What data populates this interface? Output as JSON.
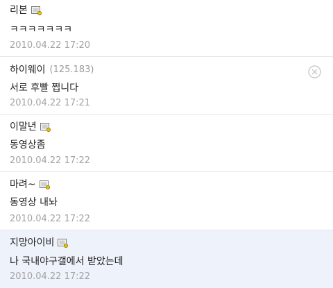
{
  "comments": [
    {
      "author": "리본",
      "ip": "",
      "member_icon": "member-badge-icon",
      "text": "ㅋㅋㅋㅋㅋㅋㅋ",
      "time": "2010.04.22 17:20"
    },
    {
      "author": "하이웨이",
      "ip": "(125.183)",
      "member_icon": "",
      "text": "서로 후빨 쩝니다",
      "time": "2010.04.22 17:21",
      "action_icon": "close-circle-icon"
    },
    {
      "author": "이말년",
      "ip": "",
      "member_icon": "member-badge-icon",
      "text": "동영상좀",
      "time": "2010.04.22 17:22"
    },
    {
      "author": "마려~",
      "ip": "",
      "member_icon": "member-badge-icon",
      "text": "동영상 내놔",
      "time": "2010.04.22 17:22"
    },
    {
      "author": "지망아이비",
      "ip": "",
      "member_icon": "member-badge-icon",
      "text": "나 국내야구갤에서 받았는데",
      "time": "2010.04.22 17:22"
    }
  ],
  "colors": {
    "highlight_bg": "#eef2fb",
    "divider": "#e6e6e6",
    "meta_text": "#a3a3a3"
  }
}
